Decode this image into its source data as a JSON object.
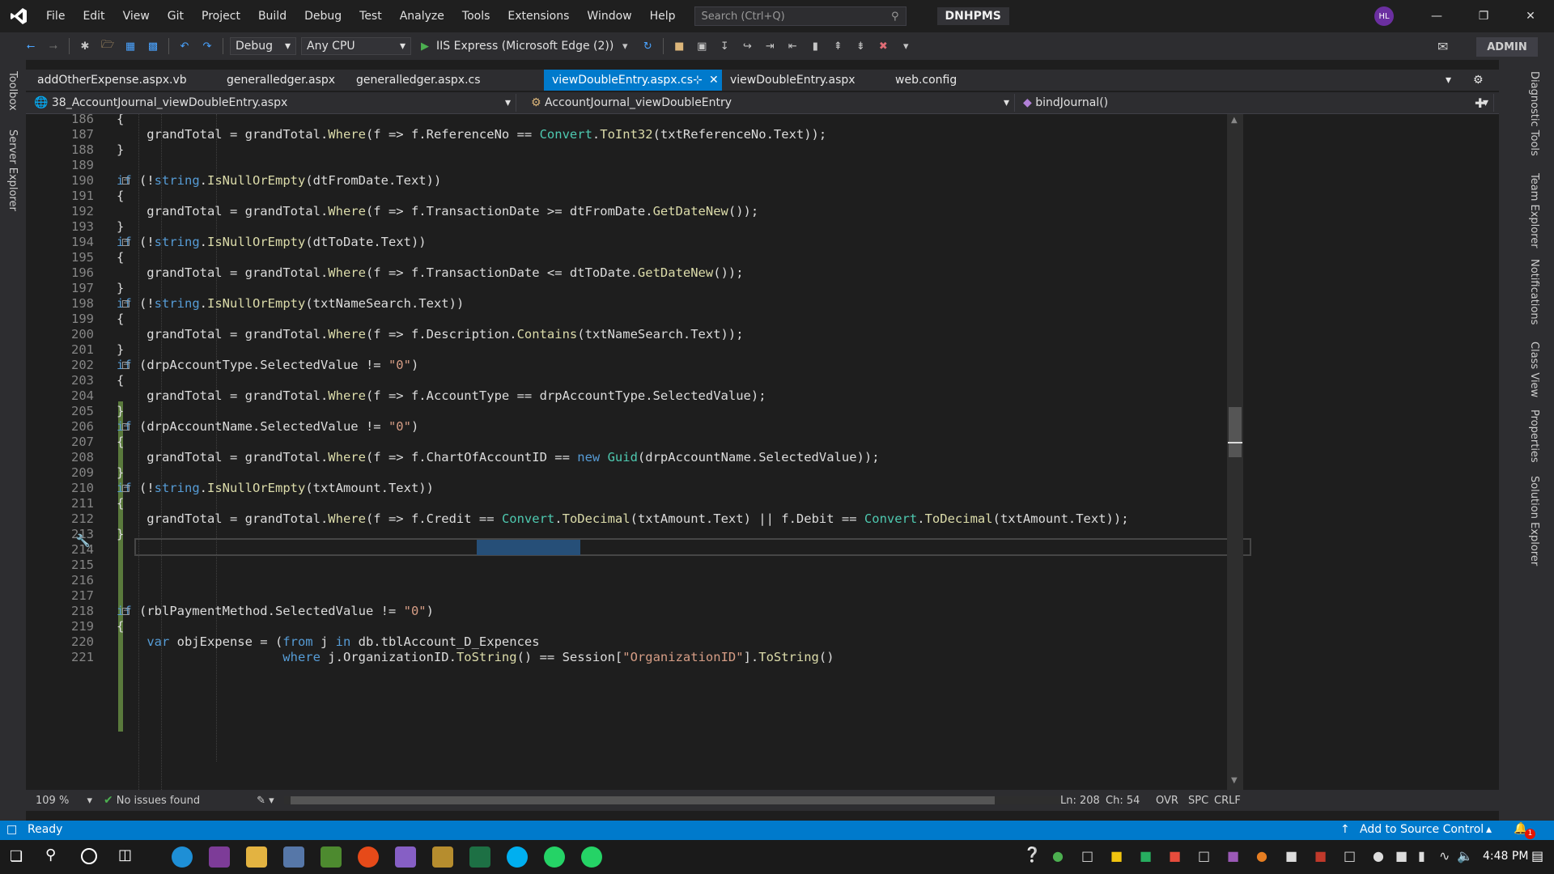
{
  "titlebar": {
    "menu": [
      "File",
      "Edit",
      "View",
      "Git",
      "Project",
      "Build",
      "Debug",
      "Test",
      "Analyze",
      "Tools",
      "Extensions",
      "Window",
      "Help"
    ],
    "search_placeholder": "Search (Ctrl+Q)",
    "solution_name": "DNHPMS",
    "avatar_initials": "HL"
  },
  "toolbar": {
    "config": "Debug",
    "platform": "Any CPU",
    "run_target": "IIS Express (Microsoft Edge (2))",
    "admin_label": "ADMIN"
  },
  "side_panels": {
    "left": [
      "Toolbox",
      "Server Explorer"
    ],
    "right": [
      "Diagnostic Tools",
      "Team Explorer",
      "Notifications",
      "Class View",
      "Properties",
      "Solution Explorer"
    ]
  },
  "tabs": [
    {
      "label": "addOtherExpense.aspx.vb",
      "active": false
    },
    {
      "label": "generalledger.aspx",
      "active": false
    },
    {
      "label": "generalledger.aspx.cs",
      "active": false
    },
    {
      "label": "viewDoubleEntry.aspx.cs",
      "active": true
    },
    {
      "label": "viewDoubleEntry.aspx",
      "active": false
    },
    {
      "label": "web.config",
      "active": false
    }
  ],
  "navbar": {
    "project": "38_AccountJournal_viewDoubleEntry.aspx",
    "class": "AccountJournal_viewDoubleEntry",
    "member": "bindJournal()"
  },
  "editor": {
    "line_numbers": [
      "186",
      "187",
      "188",
      "189",
      "190",
      "191",
      "192",
      "193",
      "194",
      "195",
      "196",
      "197",
      "198",
      "199",
      "200",
      "201",
      "202",
      "203",
      "204",
      "205",
      "206",
      "207",
      "208",
      "209",
      "210",
      "211",
      "212",
      "213",
      "214",
      "215",
      "216",
      "217",
      "218",
      "219",
      "220",
      "221"
    ],
    "code_lines": [
      "            {",
      "                grandTotal = grandTotal.Where(f => f.ReferenceNo == Convert.ToInt32(txtReferenceNo.Text));",
      "            }",
      "",
      "            if (!string.IsNullOrEmpty(dtFromDate.Text))",
      "            {",
      "                grandTotal = grandTotal.Where(f => f.TransactionDate >= dtFromDate.GetDateNew());",
      "            }",
      "            if (!string.IsNullOrEmpty(dtToDate.Text))",
      "            {",
      "                grandTotal = grandTotal.Where(f => f.TransactionDate <= dtToDate.GetDateNew());",
      "            }",
      "            if (!string.IsNullOrEmpty(txtNameSearch.Text))",
      "            {",
      "                grandTotal = grandTotal.Where(f => f.Description.Contains(txtNameSearch.Text));",
      "            }",
      "            if (drpAccountType.SelectedValue != \"0\")",
      "            {",
      "                grandTotal = grandTotal.Where(f => f.AccountType == drpAccountType.SelectedValue);",
      "            }",
      "            if (drpAccountName.SelectedValue != \"0\")",
      "            {",
      "                grandTotal = grandTotal.Where(f => f.ChartOfAccountID == new Guid(drpAccountName.SelectedValue));",
      "            }",
      "            if (!string.IsNullOrEmpty(txtAmount.Text))",
      "            {",
      "                grandTotal = grandTotal.Where(f => f.Credit == Convert.ToDecimal(txtAmount.Text) || f.Debit == Convert.ToDecimal(txtAmount.Text));",
      "            }",
      "",
      "",
      "",
      "",
      "            if (rblPaymentMethod.SelectedValue != \"0\")",
      "            {",
      "                var objExpense = (from j in db.tblAccount_D_Expences",
      "                                  where j.OrganizationID.ToString() == Session[\"OrganizationID\"].ToString()"
    ]
  },
  "editor_status": {
    "zoom": "109 %",
    "issues": "No issues found",
    "line": "Ln: 208",
    "col": "Ch: 54",
    "mode": "OVR",
    "spacing": "SPC",
    "eol": "CRLF"
  },
  "statusbar": {
    "state": "Ready",
    "source_control": "Add to Source Control",
    "notifications": "1"
  },
  "taskbar": {
    "time": "4:48 PM"
  },
  "colors": {
    "accent": "#007acc",
    "keyword": "#569cd6",
    "type": "#4ec9b0",
    "method": "#dcdcaa",
    "string": "#d69d85"
  }
}
